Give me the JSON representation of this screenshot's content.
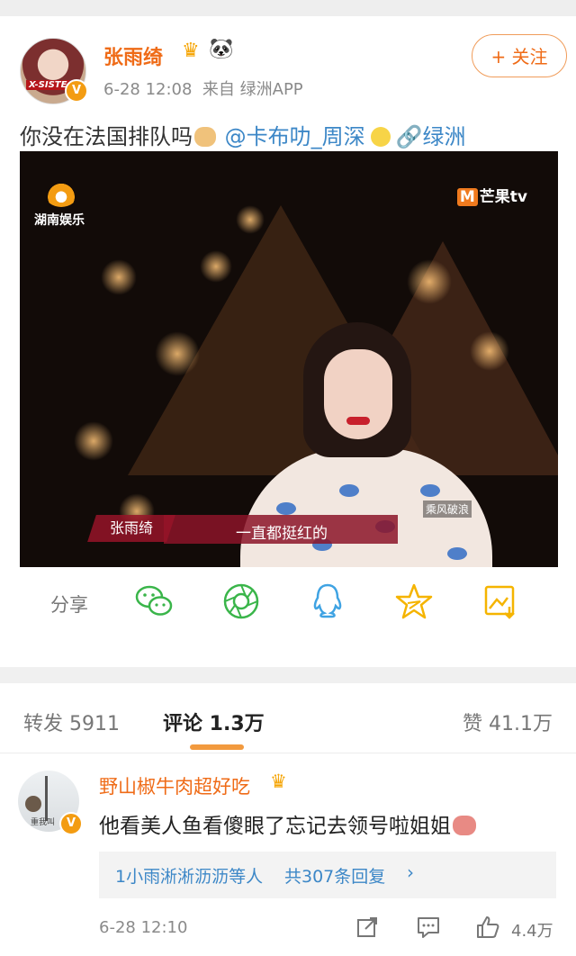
{
  "post": {
    "username": "张雨绮",
    "crown_icon": "crown-icon",
    "panda_icon": "panda-icon",
    "time": "6-28 12:08",
    "source": "来自 绿洲APP",
    "follow_label": "+ 关注",
    "avatar_badge": "X-SISTE",
    "text_main": "你没在法国排队吗",
    "mention": "@卡布叻_周深",
    "link": "绿洲"
  },
  "video": {
    "logo_left": "湖南娱乐",
    "logo_right_m": "M",
    "logo_right": "芒果tv",
    "caption_name": "张雨绮",
    "caption_text": "一直都挺红的",
    "show_tag": "乘风破浪"
  },
  "share": {
    "label": "分享",
    "icons": [
      "wechat-icon",
      "moments-icon",
      "qq-icon",
      "qzone-star-icon",
      "save-image-icon"
    ]
  },
  "tabs": {
    "repost": "转发 5911",
    "comment": "评论 1.3万",
    "like": "赞 41.1万"
  },
  "comment": {
    "name": "野山椒牛肉超好吃",
    "text": "他看美人鱼看傻眼了忘记去领号啦姐姐",
    "reply_users": "1小雨淅淅沥沥等人",
    "reply_count": "共307条回复",
    "time": "6-28 12:10",
    "likes": "4.4万",
    "avatar_text": "重我叫"
  },
  "colors": {
    "accent_orange": "#ef6b17",
    "link_blue": "#3c87c7",
    "wechat_green": "#3ab54a",
    "qq_blue": "#3fa3e3",
    "star_yellow": "#f5b400"
  }
}
